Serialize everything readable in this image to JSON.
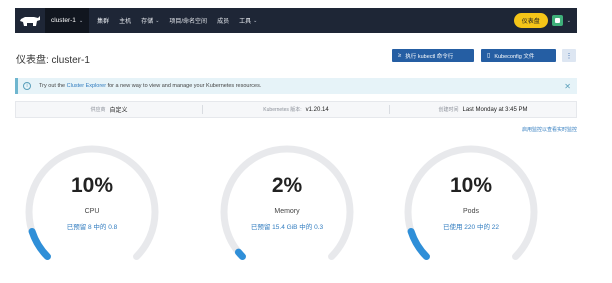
{
  "nav": {
    "cluster": "cluster-1",
    "items": [
      {
        "label": "集群",
        "dropdown": false
      },
      {
        "label": "主机",
        "dropdown": false
      },
      {
        "label": "存储",
        "dropdown": true
      },
      {
        "label": "项目/命名空间",
        "dropdown": false
      },
      {
        "label": "成员",
        "dropdown": false
      },
      {
        "label": "工具",
        "dropdown": true
      }
    ],
    "dashboard": "仪表盘",
    "logo_icon": "rancher-cow-icon"
  },
  "header": {
    "title": "仪表盘: cluster-1",
    "kubectl_button": "执行 kubectl 命令行",
    "kubeconfig_button": "Kubeconfig 文件",
    "more_button": "⋮"
  },
  "banner": {
    "text_before": "Try out the ",
    "link": "Cluster Explorer",
    "text_after": " for a new way to view and manage your Kubernetes resources."
  },
  "info": {
    "provider_label": "供应商",
    "provider_value": "自定义",
    "k8s_label": "Kubernetes 版本:",
    "k8s_value": "v1.20.14",
    "created_label": "创建时间",
    "created_value": "Last Monday at 3:45 PM"
  },
  "live_link": "启用监控以查看实时监控",
  "gauges": [
    {
      "percent": "10%",
      "label": "CPU",
      "detail": "已预留 8 中的 0.8",
      "value": 0.1
    },
    {
      "percent": "2%",
      "label": "Memory",
      "detail": "已预留 15.4 GiB 中的 0.3",
      "value": 0.02
    },
    {
      "percent": "10%",
      "label": "Pods",
      "detail": "已使用 220 中的 22",
      "value": 0.1
    }
  ],
  "colors": {
    "nav_bg": "#1e2636",
    "accent": "#255ea3",
    "gauge_fill": "#2f8fd8",
    "gauge_track": "#e8e9ec",
    "dashboard_pill": "#f5c518"
  }
}
